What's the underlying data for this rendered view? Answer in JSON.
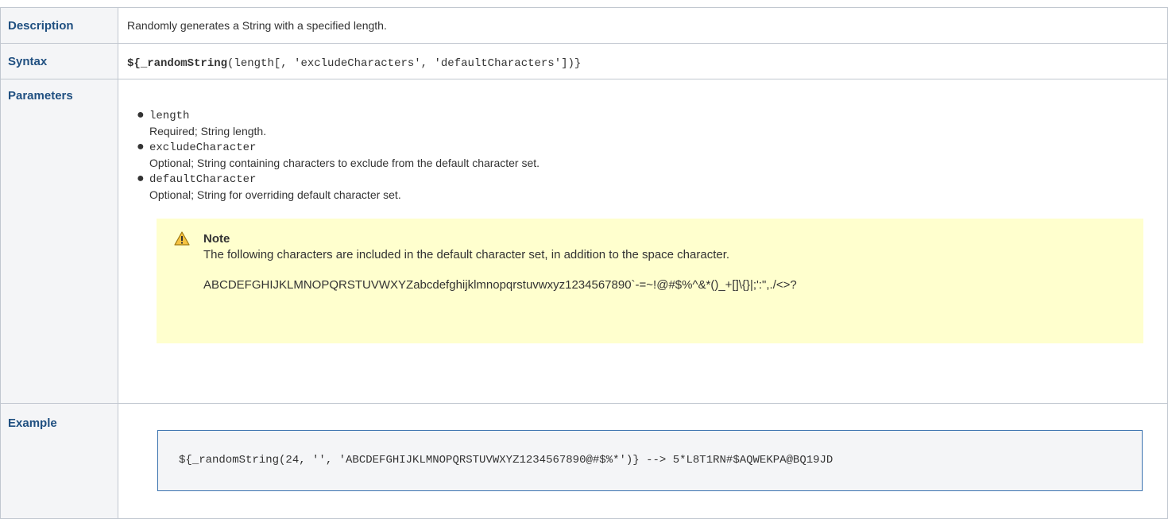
{
  "rows": {
    "description": {
      "label": "Description",
      "text": "Randomly generates a String with a specified length."
    },
    "syntax": {
      "label": "Syntax",
      "dollar": "${",
      "function": "_randomString",
      "args": "(length[, 'excludeCharacters', 'defaultCharacters'])}"
    },
    "parameters": {
      "label": "Parameters",
      "items": [
        {
          "name": "length",
          "desc": "Required; String length."
        },
        {
          "name": "excludeCharacter",
          "desc": "Optional; String containing characters to exclude from the default character set."
        },
        {
          "name": "defaultCharacter",
          "desc": "Optional; String for overriding default character set."
        }
      ],
      "note": {
        "icon": "warning-icon",
        "title": "Note",
        "body": "The following characters are included in the default character set, in addition to the space character.",
        "characters": "ABCDEFGHIJKLMNOPQRSTUVWXYZabcdefghijklmnopqrstuvwxyz1234567890`-=~!@#$%^&*()_+[]\\{}|;':\",./<>?"
      }
    },
    "example": {
      "label": "Example",
      "code": "${_randomString(24, '', 'ABCDEFGHIJKLMNOPQRSTUVWXYZ1234567890@#$%*')} --> 5*L8T1RN#$AQWEKPA@BQ19JD"
    }
  },
  "colors": {
    "header_text": "#205081",
    "header_bg": "#f4f5f7",
    "note_bg": "#ffffce",
    "code_border": "#3b73af"
  }
}
